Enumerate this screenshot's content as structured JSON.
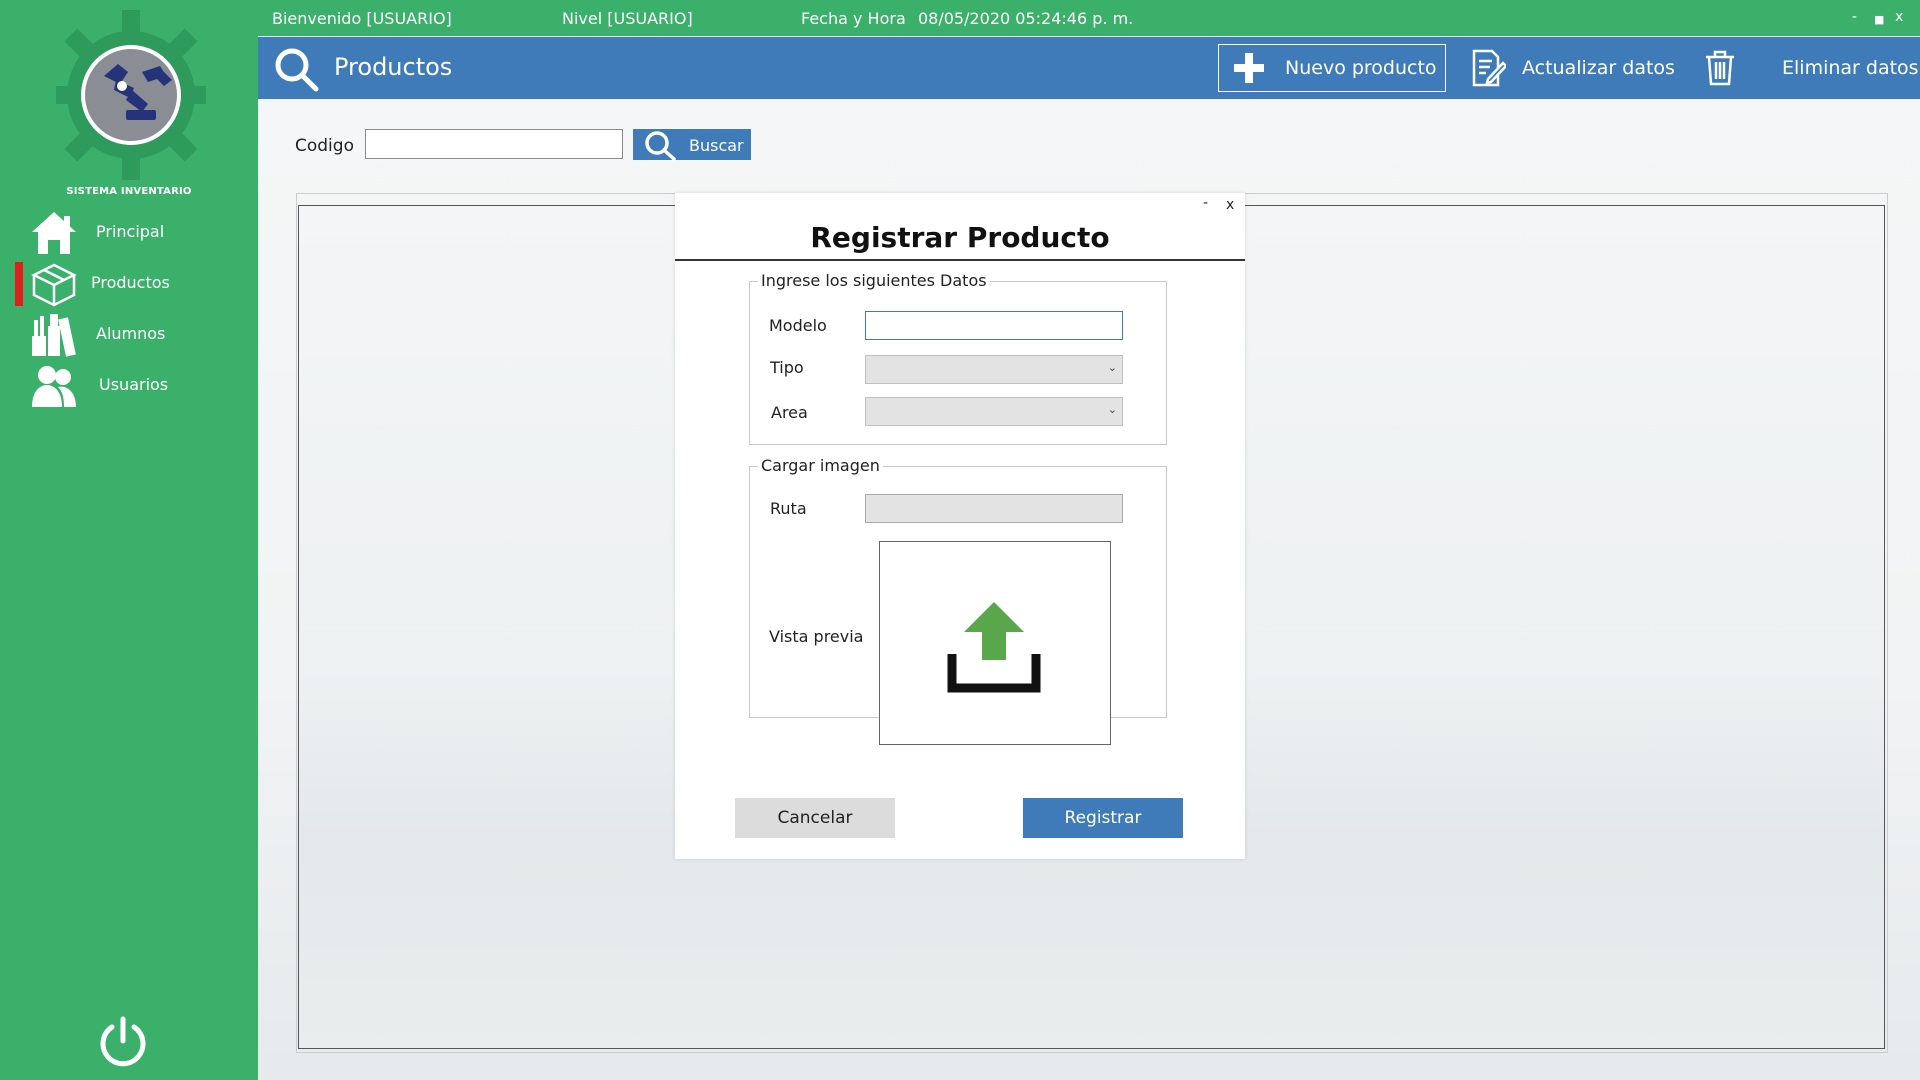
{
  "app": {
    "logo_caption": "SISTEMA INVENTARIO"
  },
  "sidebar": {
    "items": [
      {
        "label": "Principal",
        "icon": "home-icon"
      },
      {
        "label": "Productos",
        "icon": "box-icon",
        "active": true
      },
      {
        "label": "Alumnos",
        "icon": "school-supplies-icon"
      },
      {
        "label": "Usuarios",
        "icon": "users-icon"
      }
    ],
    "power_icon": "power-icon"
  },
  "topbar": {
    "welcome": "Bienvenido [USUARIO]",
    "level": "Nivel [USUARIO]",
    "datetime_label": "Fecha y Hora",
    "datetime_value": "08/05/2020 05:24:46 p. m.",
    "minimize": "-",
    "maximize": "■",
    "close": "x"
  },
  "header": {
    "title": "Productos",
    "new_product": "Nuevo producto",
    "update_data": "Actualizar datos",
    "delete_data": "Eliminar datos"
  },
  "search": {
    "label": "Codigo",
    "value": "",
    "button": "Buscar"
  },
  "modal": {
    "title": "Registrar Producto",
    "minimize": "-",
    "close": "x",
    "group_data": {
      "legend": "Ingrese los siguientes Datos",
      "modelo_label": "Modelo",
      "modelo_value": "",
      "tipo_label": "Tipo",
      "tipo_value": "",
      "area_label": "Area",
      "area_value": ""
    },
    "group_image": {
      "legend": "Cargar imagen",
      "ruta_label": "Ruta",
      "ruta_value": "",
      "preview_label": "Vista previa"
    },
    "cancel": "Cancelar",
    "register": "Registrar"
  },
  "colors": {
    "sidebar_green": "#3bb06a",
    "header_blue": "#3e7bb8",
    "active_marker": "#e0201c",
    "upload_arrow": "#5aa64a"
  }
}
